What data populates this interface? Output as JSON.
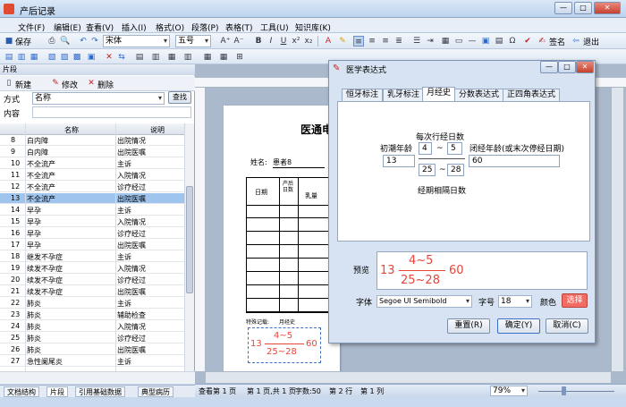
{
  "window": {
    "title": "产后记录",
    "controls": [
      "—",
      "□",
      "✕"
    ]
  },
  "menu": [
    "文件(F)",
    "编辑(E)",
    "查看(V)",
    "插入(I)",
    "格式(O)",
    "段落(P)",
    "表格(T)",
    "工具(U)",
    "知识库(K)"
  ],
  "toolbar": {
    "save": "保存",
    "font": "宋体",
    "size": "五号",
    "sign": "签名",
    "exit": "退出"
  },
  "panel": {
    "title": "片段",
    "new": "新建",
    "edit": "修改",
    "delete": "删除",
    "mode_label": "方式",
    "mode_value": "名称",
    "search": "查找",
    "content_label": "内容",
    "col_name": "名称",
    "col_desc": "说明",
    "rows": [
      {
        "n": "8",
        "name": "白内障",
        "desc": "出院情况"
      },
      {
        "n": "9",
        "name": "白内障",
        "desc": "出院医嘱"
      },
      {
        "n": "10",
        "name": "不全流产",
        "desc": "主诉"
      },
      {
        "n": "11",
        "name": "不全流产",
        "desc": "入院情况"
      },
      {
        "n": "12",
        "name": "不全流产",
        "desc": "诊疗经过"
      },
      {
        "n": "13",
        "name": "不全流产",
        "desc": "出院医嘱"
      },
      {
        "n": "14",
        "name": "早孕",
        "desc": "主诉"
      },
      {
        "n": "15",
        "name": "早孕",
        "desc": "入院情况"
      },
      {
        "n": "16",
        "name": "早孕",
        "desc": "诊疗经过"
      },
      {
        "n": "17",
        "name": "早孕",
        "desc": "出院医嘱"
      },
      {
        "n": "18",
        "name": "继发不孕症",
        "desc": "主诉"
      },
      {
        "n": "19",
        "name": "续发不孕症",
        "desc": "入院情况"
      },
      {
        "n": "20",
        "name": "续发不孕症",
        "desc": "诊疗经过"
      },
      {
        "n": "21",
        "name": "续发不孕症",
        "desc": "出院医嘱"
      },
      {
        "n": "22",
        "name": "肺炎",
        "desc": "主诉"
      },
      {
        "n": "23",
        "name": "肺炎",
        "desc": "辅助检查"
      },
      {
        "n": "24",
        "name": "肺炎",
        "desc": "入院情况"
      },
      {
        "n": "25",
        "name": "肺炎",
        "desc": "诊疗经过"
      },
      {
        "n": "26",
        "name": "肺炎",
        "desc": "出院医嘱"
      },
      {
        "n": "27",
        "name": "急性阑尾炎",
        "desc": "主诉"
      }
    ]
  },
  "bottom_tabs": [
    "文档结构",
    "片段",
    "引用基础数据",
    "典型病历"
  ],
  "document": {
    "header": "医通电",
    "name_label": "姓名:",
    "name_value": "患者8",
    "col_date": "日期",
    "col_postpartum": "产后日数",
    "col_breast": "乳量",
    "special_label": "特殊记载:",
    "history_label": "月经史",
    "fx_left": "13",
    "fx_top": "4~5",
    "fx_bottom": "25~28",
    "fx_right": "60"
  },
  "status": {
    "pages": "查看第 1 页",
    "page_of": "第 1 页,共 1 页",
    "chars": "字数:50",
    "row": "第 2 行",
    "col": "第 1 列",
    "zoom": "79%"
  },
  "dialog": {
    "title": "医学表达式",
    "tabs": [
      "恒牙标注",
      "乳牙标注",
      "月经史",
      "分数表达式",
      "正四角表达式"
    ],
    "label_cycle": "每次行经日数",
    "label_menarche": "初潮年龄",
    "label_lmp": "闭经年龄(或末次停经日期)",
    "label_interval": "经期相隔日数",
    "val_menarche": "13",
    "val_days_a": "4",
    "val_days_b": "5",
    "val_lmp": "60",
    "val_int_a": "25",
    "val_int_b": "28",
    "tilde": "~",
    "preview_label": "预览",
    "font_label": "字体",
    "font_value": "Segoe UI Semibold",
    "size_label": "字号",
    "size_value": "18",
    "color_label": "颜色",
    "color_button": "选择",
    "reset": "重置(R)",
    "ok": "确定(Y)",
    "cancel": "取消(C)"
  },
  "colors": {
    "accent": "#e8463a",
    "selection": "#9fc4ee"
  }
}
